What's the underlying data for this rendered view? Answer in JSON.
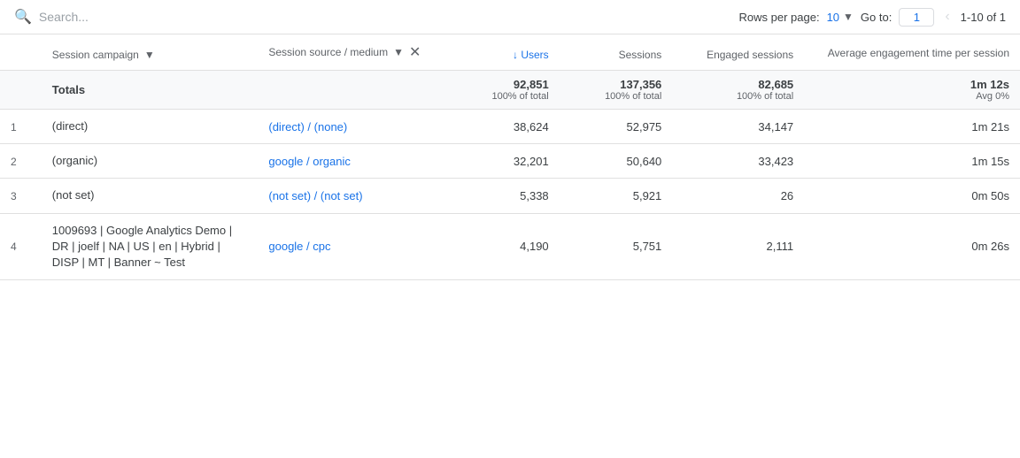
{
  "search": {
    "placeholder": "Search..."
  },
  "pagination": {
    "rows_per_page_label": "Rows per page:",
    "rows_value": "10",
    "goto_label": "Go to:",
    "goto_value": "1",
    "range": "1-10 of 1"
  },
  "table": {
    "columns": [
      {
        "id": "row_num",
        "label": "",
        "numeric": false
      },
      {
        "id": "campaign",
        "label": "Session campaign",
        "sortable": true,
        "numeric": false
      },
      {
        "id": "source",
        "label": "Session source / medium",
        "sortable": true,
        "has_filter": true,
        "numeric": false
      },
      {
        "id": "users",
        "label": "↓ Users",
        "numeric": true,
        "sorted": true
      },
      {
        "id": "sessions",
        "label": "Sessions",
        "numeric": true
      },
      {
        "id": "engaged_sessions",
        "label": "Engaged sessions",
        "numeric": true
      },
      {
        "id": "avg_engagement",
        "label": "Average engagement time per session",
        "numeric": true
      }
    ],
    "totals": {
      "label": "Totals",
      "users": "92,851",
      "users_sub": "100% of total",
      "sessions": "137,356",
      "sessions_sub": "100% of total",
      "engaged_sessions": "82,685",
      "engaged_sessions_sub": "100% of total",
      "avg_engagement": "1m 12s",
      "avg_engagement_sub": "Avg 0%"
    },
    "rows": [
      {
        "num": "1",
        "campaign": "(direct)",
        "source": "(direct) / (none)",
        "users": "38,624",
        "sessions": "52,975",
        "engaged_sessions": "34,147",
        "avg_engagement": "1m 21s"
      },
      {
        "num": "2",
        "campaign": "(organic)",
        "source": "google / organic",
        "users": "32,201",
        "sessions": "50,640",
        "engaged_sessions": "33,423",
        "avg_engagement": "1m 15s"
      },
      {
        "num": "3",
        "campaign": "(not set)",
        "source": "(not set) / (not set)",
        "users": "5,338",
        "sessions": "5,921",
        "engaged_sessions": "26",
        "avg_engagement": "0m 50s"
      },
      {
        "num": "4",
        "campaign": "1009693 | Google Analytics Demo | DR | joelf | NA | US | en | Hybrid | DISP | MT | Banner ~ Test",
        "source": "google / cpc",
        "users": "4,190",
        "sessions": "5,751",
        "engaged_sessions": "2,111",
        "avg_engagement": "0m 26s"
      }
    ]
  }
}
